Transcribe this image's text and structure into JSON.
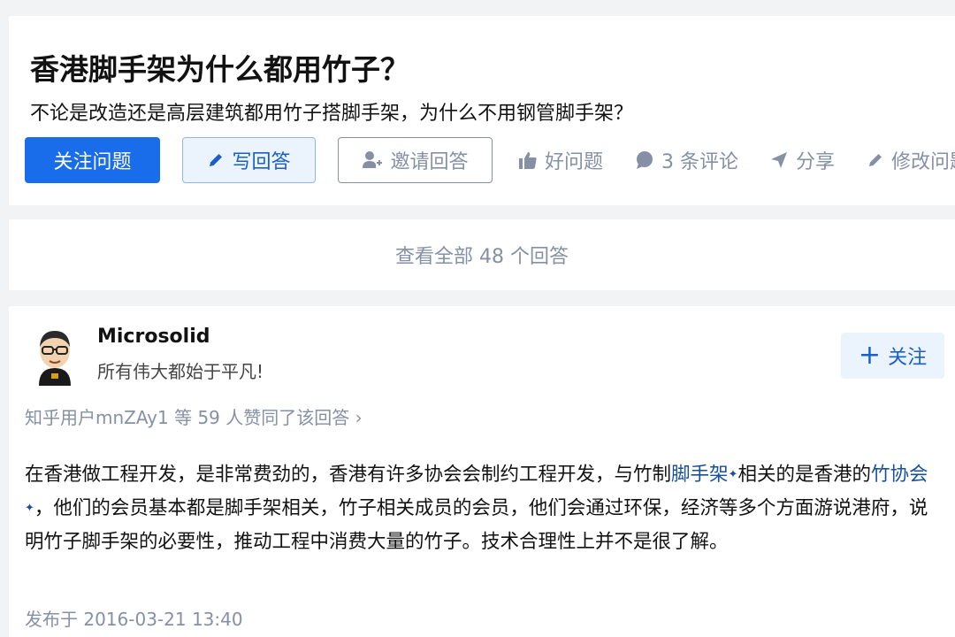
{
  "question": {
    "title": "香港脚手架为什么都用竹子？",
    "detail": "不论是改造还是高层建筑都用竹子搭脚手架，为什么不用钢管脚手架？",
    "follow_label": "关注问题",
    "write_label": "写回答",
    "invite_label": "邀请回答",
    "actions": {
      "good_question": "好问题",
      "comments": "3 条评论",
      "share": "分享",
      "edit": "修改问题"
    }
  },
  "view_all": {
    "label": "查看全部 48 个回答"
  },
  "answer": {
    "author_name": "Microsolid",
    "author_bio": "所有伟大都始于平凡!",
    "follow_label": "关注",
    "follow_plus": "+",
    "upvote_text": "知乎用户mnZAy1 等 59 人赞同了该回答",
    "upvote_chevron": "›",
    "body_part1": "在香港做工程开发，是非常费劲的，香港有许多协会会制约工程开发，与竹制",
    "link1": "脚手架",
    "body_part2": "相关的是香港的",
    "link2": "竹协会",
    "body_part3": "，他们的会员基本都是脚手架相关，竹子相关成员的会员，他们会通过环保，经济等多个方面游说港府，说明竹子脚手架的必要性，推动工程中消费大量的竹子。技术合理性上并不是很了解。",
    "sparkle": "✦",
    "publish_time": "发布于 2016-03-21 13:40"
  },
  "colors": {
    "primary": "#1a6dea",
    "link": "#175199",
    "muted": "#8590a6",
    "background": "#f2f3f5"
  }
}
